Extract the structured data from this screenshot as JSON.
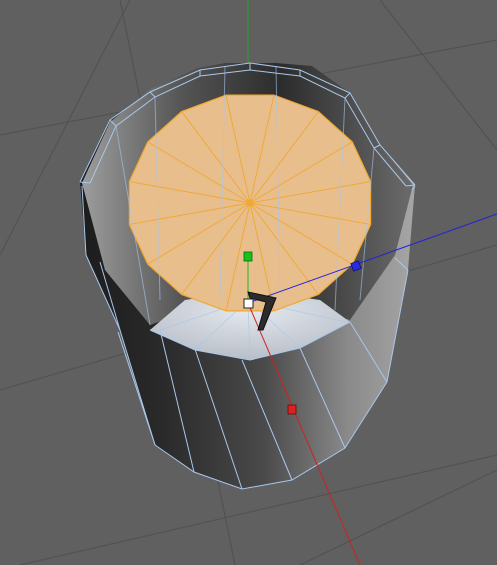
{
  "viewport": {
    "name": "3d-viewport",
    "background": "#606060",
    "grid_color": "#545454",
    "view": "perspective"
  },
  "scene": {
    "object": "cylinder",
    "segments": 16,
    "selected_polygon": "top-cap",
    "wire_color": "#a9c7ec",
    "selection_color": "#f0a830",
    "selection_fill": "#e8be8c",
    "shell_dark": "#1e1e1e",
    "shell_light": "#9a9a9a",
    "inner_floor": "#c6ccd6"
  },
  "gizmo": {
    "x_axis_color": "#d02020",
    "y_axis_color": "#22bb22",
    "z_axis_color": "#2222dd",
    "handles": [
      "x-handle",
      "y-handle",
      "z-handle",
      "center-handle"
    ]
  }
}
